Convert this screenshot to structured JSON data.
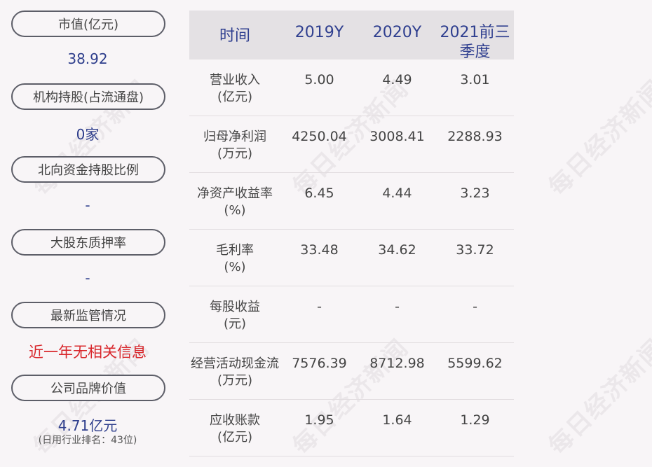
{
  "left_panel": {
    "items": [
      {
        "label": "市值(亿元)",
        "value": "38.92"
      },
      {
        "label": "机构持股(占流通盘)",
        "value": "0家"
      },
      {
        "label": "北向资金持股比例",
        "value": "-"
      },
      {
        "label": "大股东质押率",
        "value": "-"
      },
      {
        "label": "最新监管情况",
        "value": "近一年无相关信息"
      },
      {
        "label": "公司品牌价值",
        "value": "4.71亿元",
        "note": "(日用行业排名：43位)"
      }
    ]
  },
  "table": {
    "headers": [
      "时间",
      "2019Y",
      "2020Y",
      "2021前三季度"
    ],
    "rows": [
      {
        "label_line1": "营业收入",
        "label_line2": "(亿元)",
        "values": [
          "5.00",
          "4.49",
          "3.01"
        ]
      },
      {
        "label_line1": "归母净利润",
        "label_line2": "(万元)",
        "values": [
          "4250.04",
          "3008.41",
          "2288.93"
        ]
      },
      {
        "label_line1": "净资产收益率",
        "label_line2": "(%)",
        "values": [
          "6.45",
          "4.44",
          "3.23"
        ]
      },
      {
        "label_line1": "毛利率",
        "label_line2": "(%)",
        "values": [
          "33.48",
          "34.62",
          "33.72"
        ]
      },
      {
        "label_line1": "每股收益",
        "label_line2": "(元)",
        "values": [
          "-",
          "-",
          "-"
        ]
      },
      {
        "label_line1": "经营活动现金流",
        "label_line2": "(万元)",
        "values": [
          "7576.39",
          "8712.98",
          "5599.62"
        ]
      },
      {
        "label_line1": "应收账款",
        "label_line2": "(亿元)",
        "values": [
          "1.95",
          "1.64",
          "1.29"
        ]
      }
    ]
  },
  "watermark_text": "每日经济新闻",
  "colors": {
    "accent_blue": "#2e3e8c",
    "accent_red": "#d8262b",
    "header_bg": "#e4e1e4"
  }
}
